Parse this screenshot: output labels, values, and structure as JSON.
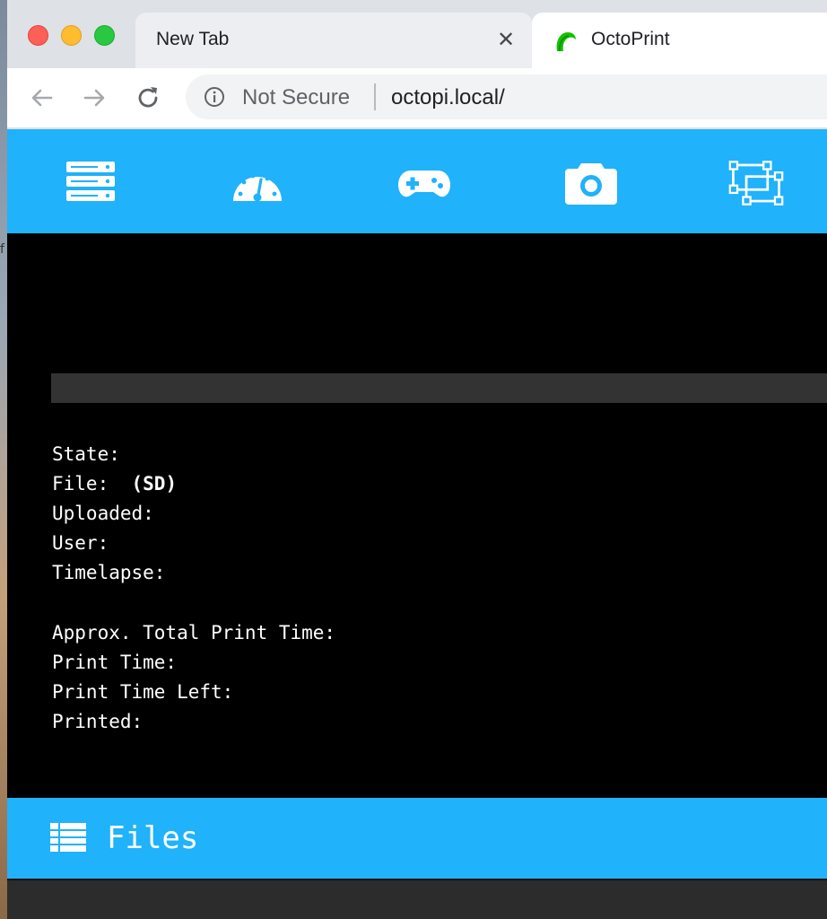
{
  "browser": {
    "tabs": [
      {
        "label": "New Tab",
        "active": false,
        "close_icon": "close-icon"
      },
      {
        "label": "OctoPrint",
        "active": true,
        "favicon": "octoprint-logo-icon"
      }
    ],
    "address_bar": {
      "security_label": "Not Secure",
      "url": "octopi.local/"
    }
  },
  "navbar": {
    "icons": [
      "server-stack-icon",
      "dashboard-gauge-icon",
      "gamepad-icon",
      "camera-icon",
      "object-group-icon"
    ]
  },
  "state": {
    "progress_percent": 0,
    "rows": [
      {
        "label": "State:",
        "value": ""
      },
      {
        "label": "File:",
        "value": "(SD)"
      },
      {
        "label": "Uploaded:",
        "value": ""
      },
      {
        "label": "User:",
        "value": ""
      },
      {
        "label": "Timelapse:",
        "value": ""
      },
      {
        "label": "Approx. Total Print Time:",
        "value": ""
      },
      {
        "label": "Print Time:",
        "value": ""
      },
      {
        "label": "Print Time Left:",
        "value": ""
      },
      {
        "label": "Printed:",
        "value": ""
      }
    ]
  },
  "files": {
    "title": "Files",
    "icon": "list-icon"
  },
  "colors": {
    "accent": "#20b2fa",
    "panel_bg": "#000000",
    "progress_track": "#333333"
  }
}
